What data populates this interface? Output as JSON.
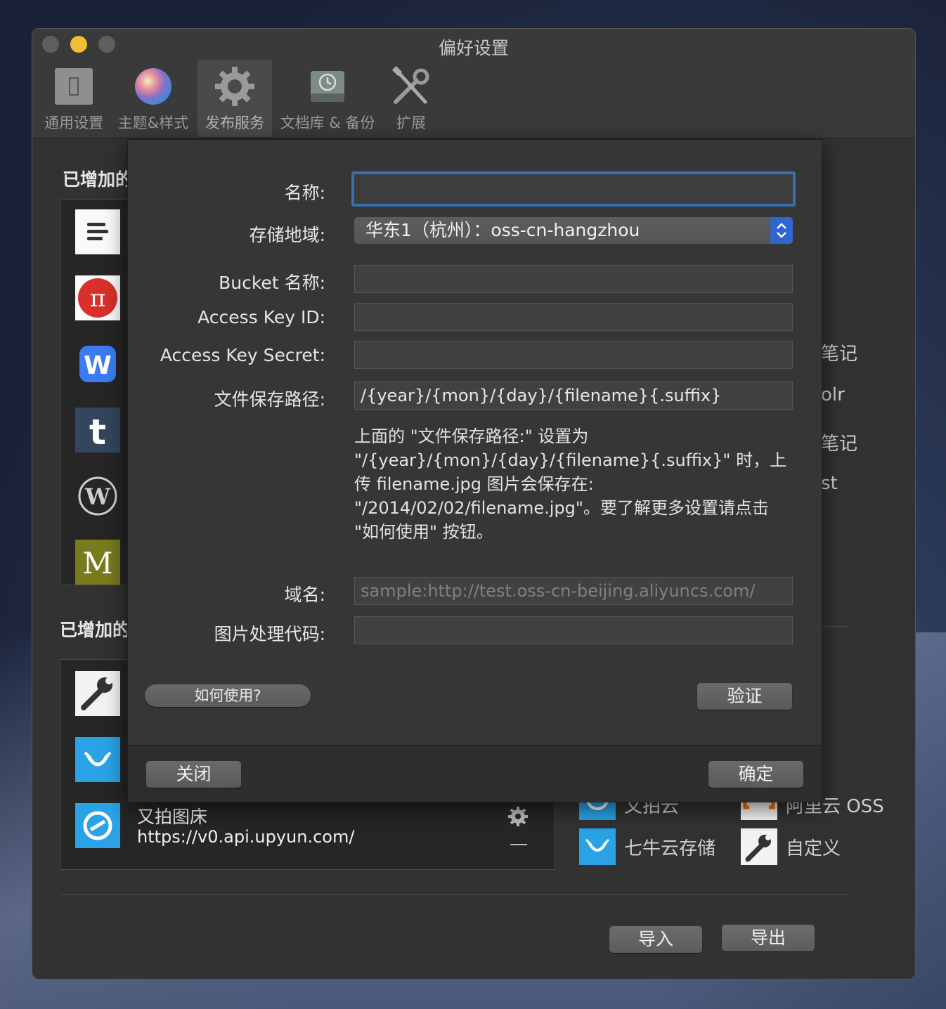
{
  "window": {
    "title": "偏好设置"
  },
  "toolbar": {
    "items": [
      {
        "label": "通用设置"
      },
      {
        "label": "主题&样式"
      },
      {
        "label": "发布服务"
      },
      {
        "label": "文档库 & 备份"
      },
      {
        "label": "扩展"
      }
    ]
  },
  "sections": {
    "added_publish": "已增加的",
    "added_image": "已增加的"
  },
  "image_service_row": {
    "name": "又拍图床",
    "url": "https://v0.api.upyun.com/"
  },
  "right_panel": {
    "partial_labels": [
      "笔记",
      "olr",
      "笔记",
      "st"
    ],
    "service_options": [
      {
        "label": "又拍云"
      },
      {
        "label": "阿里云 OSS"
      },
      {
        "label": "七牛云存储"
      },
      {
        "label": "自定义"
      }
    ]
  },
  "bottom_buttons": {
    "import": "导入",
    "export": "导出"
  },
  "sheet": {
    "name_label": "名称:",
    "name_value": "",
    "region_label": "存储地域:",
    "region_value": "华东1（杭州）：oss-cn-hangzhou",
    "bucket_label": "Bucket 名称:",
    "bucket_value": "",
    "key_id_label": "Access Key ID:",
    "key_id_value": "",
    "key_secret_label": "Access Key Secret:",
    "key_secret_value": "",
    "path_label": "文件保存路径:",
    "path_value": "/{year}/{mon}/{day}/{filename}{.suffix}",
    "hint": "上面的 \"文件保存路径:\" 设置为 \"/{year}/{mon}/{day}/{filename}{.suffix}\" 时，上传 filename.jpg 图片会保存在: \"/2014/02/02/filename.jpg\"。要了解更多设置请点击 \"如何使用\" 按钮。",
    "domain_label": "域名:",
    "domain_placeholder": "sample:http://test.oss-cn-beijing.aliyuncs.com/",
    "processing_label": "图片处理代码:",
    "processing_value": "",
    "how_to_button": "如何使用?",
    "verify_button": "验证",
    "close_button": "关闭",
    "confirm_button": "确定"
  }
}
